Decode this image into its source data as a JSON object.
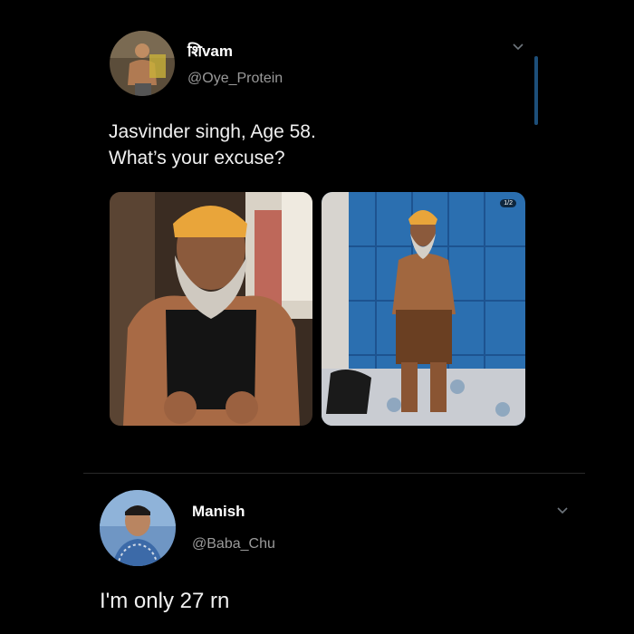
{
  "tweet": {
    "display_name": "शिvam",
    "handle": "@Oye_Protein",
    "text_line1": "Jasvinder singh, Age 58.",
    "text_line2": "What’s your excuse?",
    "media_count_badge": "1/2"
  },
  "reply": {
    "display_name": "Manish",
    "handle": "@Baba_Chu",
    "text": "I'm only 27 rn"
  },
  "colors": {
    "background": "#000000",
    "text": "#f1f1f1",
    "secondary": "#9a9a9a",
    "accent": "#1d9bf0"
  }
}
